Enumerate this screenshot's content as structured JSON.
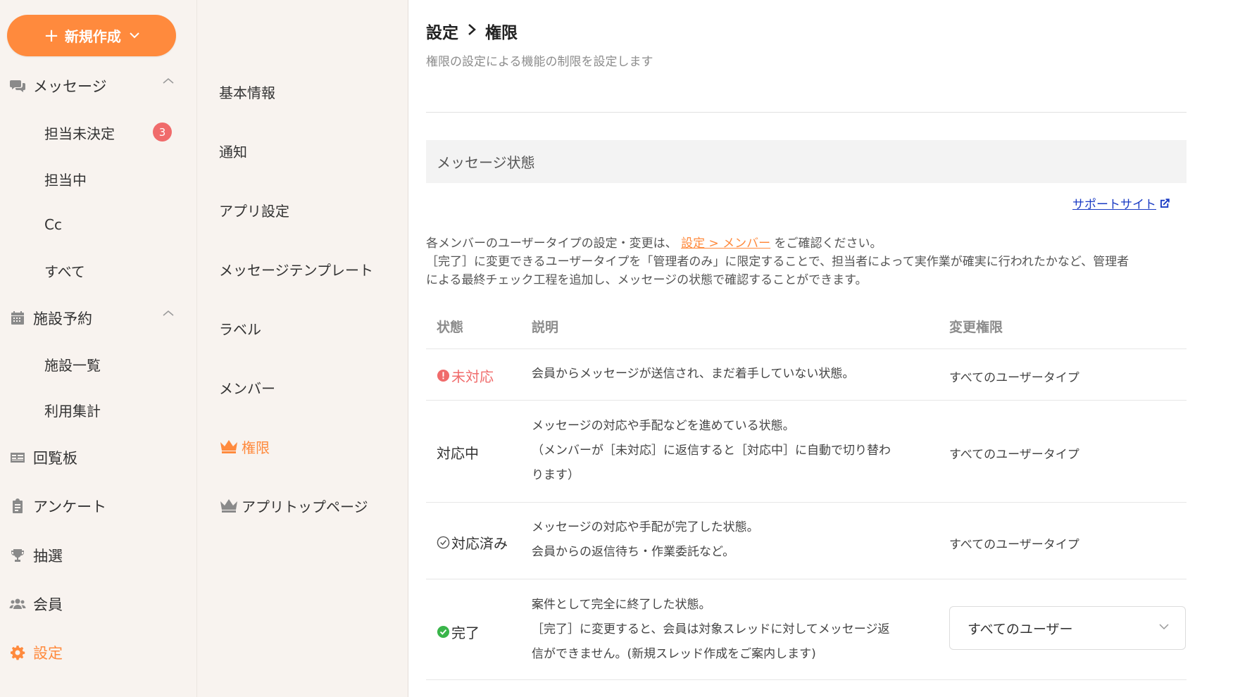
{
  "sidebar": {
    "new_button": {
      "label": "新規作成"
    },
    "message": {
      "label": "メッセージ",
      "items": [
        {
          "label": "担当未決定",
          "badge": "3"
        },
        {
          "label": "担当中"
        },
        {
          "label": "Cc"
        },
        {
          "label": "すべて"
        }
      ]
    },
    "facility": {
      "label": "施設予約",
      "items": [
        {
          "label": "施設一覧"
        },
        {
          "label": "利用集計"
        }
      ]
    },
    "bulletin": {
      "label": "回覧板"
    },
    "survey": {
      "label": "アンケート"
    },
    "lottery": {
      "label": "抽選"
    },
    "members": {
      "label": "会員"
    },
    "settings": {
      "label": "設定"
    }
  },
  "submenu": {
    "items": [
      {
        "label": "基本情報"
      },
      {
        "label": "通知"
      },
      {
        "label": "アプリ設定"
      },
      {
        "label": "メッセージテンプレート"
      },
      {
        "label": "ラベル"
      },
      {
        "label": "メンバー"
      },
      {
        "label": "権限"
      },
      {
        "label": "アプリトップページ"
      }
    ]
  },
  "main": {
    "breadcrumb": {
      "parent": "設定",
      "current": "権限"
    },
    "description": "権限の設定による機能の制限を設定します",
    "section_title": "メッセージ状態",
    "support_link": "サポートサイト",
    "info": {
      "line1_before": "各メンバーのユーザータイプの設定・変更は、",
      "line1_link": "設定 > メンバー",
      "line1_after": "をご確認ください。",
      "line2": "［完了］に変更できるユーザータイプを「管理者のみ」に限定することで、担当者によって実作業が確実に行われたかなど、管理者",
      "line3": "による最終チェック工程を追加し、メッセージの状態で確認することができます。"
    },
    "table": {
      "headers": {
        "state": "状態",
        "description": "説明",
        "permission": "変更権限"
      },
      "rows": [
        {
          "state": "未対応",
          "desc": [
            "会員からメッセージが送信され、まだ着手していない状態。"
          ],
          "permission": "すべてのユーザータイプ"
        },
        {
          "state": "対応中",
          "desc": [
            "メッセージの対応や手配などを進めている状態。",
            "（メンバーが［未対応］に返信すると［対応中］に自動で切り替わ",
            "ります）"
          ],
          "permission": "すべてのユーザータイプ"
        },
        {
          "state": "対応済み",
          "desc": [
            "メッセージの対応や手配が完了した状態。",
            "会員からの返信待ち・作業委託など。"
          ],
          "permission": "すべてのユーザータイプ"
        },
        {
          "state": "完了",
          "desc": [
            "案件として完全に終了した状態。",
            "［完了］に変更すると、会員は対象スレッドに対してメッセージ返",
            "信ができません。(新規スレッド作成をご案内します)"
          ],
          "permission_select": "すべてのユーザー"
        }
      ]
    }
  },
  "colors": {
    "accent": "#ff8a3d",
    "badge": "#f06b6b",
    "done": "#39b54a",
    "link": "#1a3bc4"
  }
}
